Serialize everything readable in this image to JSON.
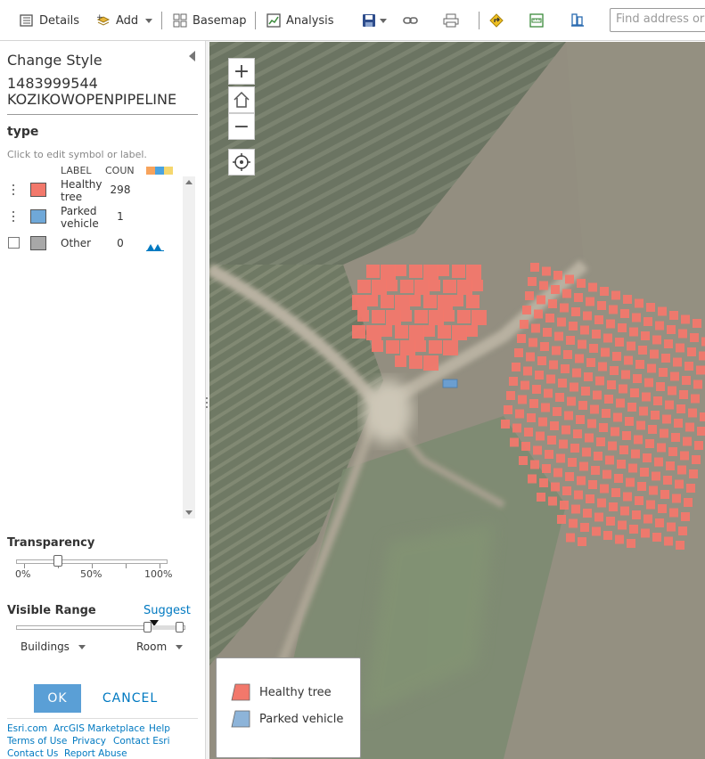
{
  "toolbar": {
    "details_label": "Details",
    "add_label": "Add",
    "basemap_label": "Basemap",
    "analysis_label": "Analysis",
    "search_placeholder": "Find address or p"
  },
  "panel": {
    "title": "Change Style",
    "layer_name_line1": "1483999544",
    "layer_name_line2": "KOZIKOWOPENPIPELINE",
    "attribute_name": "type",
    "edit_hint": "Click to edit symbol or label.",
    "col_label": "LABEL",
    "col_count": "COUN",
    "rows": [
      {
        "label_line1": "Healthy",
        "label_line2": "tree",
        "count": "298",
        "color": "#f2786b"
      },
      {
        "label_line1": "Parked",
        "label_line2": "vehicle",
        "count": "1",
        "color": "#6fa8d8"
      },
      {
        "label_line1": "Other",
        "label_line2": "",
        "count": "0",
        "color": "#a8a8a8"
      }
    ],
    "header_swatch_colors": [
      "#f7a35c",
      "#4aa3e0",
      "#f5d76e"
    ]
  },
  "transparency": {
    "label": "Transparency",
    "value_percent": 25,
    "ticks": [
      "0%",
      "50%",
      "100%"
    ]
  },
  "visible_range": {
    "label": "Visible Range",
    "suggest_label": "Suggest",
    "min_scale": "Buildings",
    "max_scale": "Room"
  },
  "buttons": {
    "ok": "OK",
    "cancel": "CANCEL"
  },
  "footer": {
    "links": [
      "Esri.com",
      "ArcGIS Marketplace",
      "Help",
      "Terms of Use",
      "Privacy",
      "Contact Esri",
      "Contact Us",
      "Report Abuse"
    ]
  },
  "map": {
    "zoom_in": "+",
    "zoom_out": "−",
    "legend": [
      {
        "label": "Healthy tree",
        "color": "#f2786b"
      },
      {
        "label": "Parked vehicle",
        "color": "#8db4d9"
      }
    ]
  },
  "colors": {
    "accent": "#0079c1",
    "ok_button": "#5a9fd6",
    "tree_fill": "#f2786b",
    "vehicle_fill": "#6fa8d8"
  }
}
